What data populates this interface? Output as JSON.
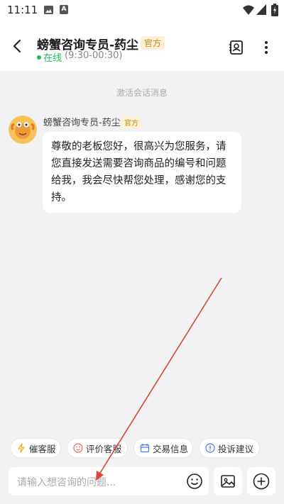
{
  "status_bar": {
    "time": "11:11",
    "icons": [
      "image-icon",
      "a-icon",
      "wifi-icon",
      "signal-icon",
      "battery-icon"
    ]
  },
  "header": {
    "agent_name": "螃蟹咨询专员-药尘",
    "official_label": "官方",
    "online_status": "在线",
    "online_hours": "(9:30-00:30)",
    "icons": [
      "back-icon",
      "contact-card-icon",
      "more-icon"
    ]
  },
  "chat": {
    "activation_notice": "激活会话消息",
    "messages": [
      {
        "sender": "螃蟹咨询专员-药尘",
        "badge": "官方",
        "text": "尊敬的老板您好，很高兴为您服务，请您直接发送需要咨询商品的编号和问题给我，我会尽快帮您处理，感谢您的支持。"
      }
    ]
  },
  "quick_actions": [
    {
      "label": "催客服",
      "icon": "lightning-icon",
      "color": "#f5a623"
    },
    {
      "label": "评价客服",
      "icon": "smile-icon",
      "color": "#e8625a"
    },
    {
      "label": "交易信息",
      "icon": "calendar-icon",
      "color": "#4a78e6"
    },
    {
      "label": "投诉建议",
      "icon": "alert-icon",
      "color": "#4a78e6"
    }
  ],
  "input": {
    "placeholder": "请输入想咨询的问题..."
  },
  "annotation": {
    "arrow_color": "#d9453a"
  }
}
